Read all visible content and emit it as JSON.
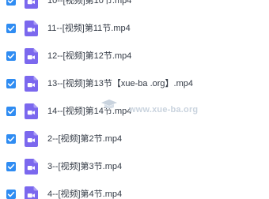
{
  "files": [
    {
      "name": "10--[视频]第10节.mp4",
      "checked": true,
      "icon": "video-file-icon"
    },
    {
      "name": "11--[视频]第11节.mp4",
      "checked": true,
      "icon": "video-file-icon"
    },
    {
      "name": "12--[视频]第12节.mp4",
      "checked": true,
      "icon": "video-file-icon"
    },
    {
      "name": "13--[视频]第13节【xue-ba .org】.mp4",
      "checked": true,
      "icon": "video-file-icon"
    },
    {
      "name": "14--[视频]第14节.mp4",
      "checked": true,
      "icon": "video-file-icon"
    },
    {
      "name": "2--[视频]第2节.mp4",
      "checked": true,
      "icon": "video-file-icon"
    },
    {
      "name": "3--[视频]第3节.mp4",
      "checked": true,
      "icon": "video-file-icon"
    },
    {
      "name": "4--[视频]第4节.mp4",
      "checked": true,
      "icon": "video-file-icon"
    }
  ],
  "watermark": {
    "text": "www.xue-ba.org"
  },
  "colors": {
    "checkbox": "#2f8cf2",
    "file_icon": "#7b68ee",
    "text": "#333a45",
    "watermark": "#c9d3de"
  }
}
